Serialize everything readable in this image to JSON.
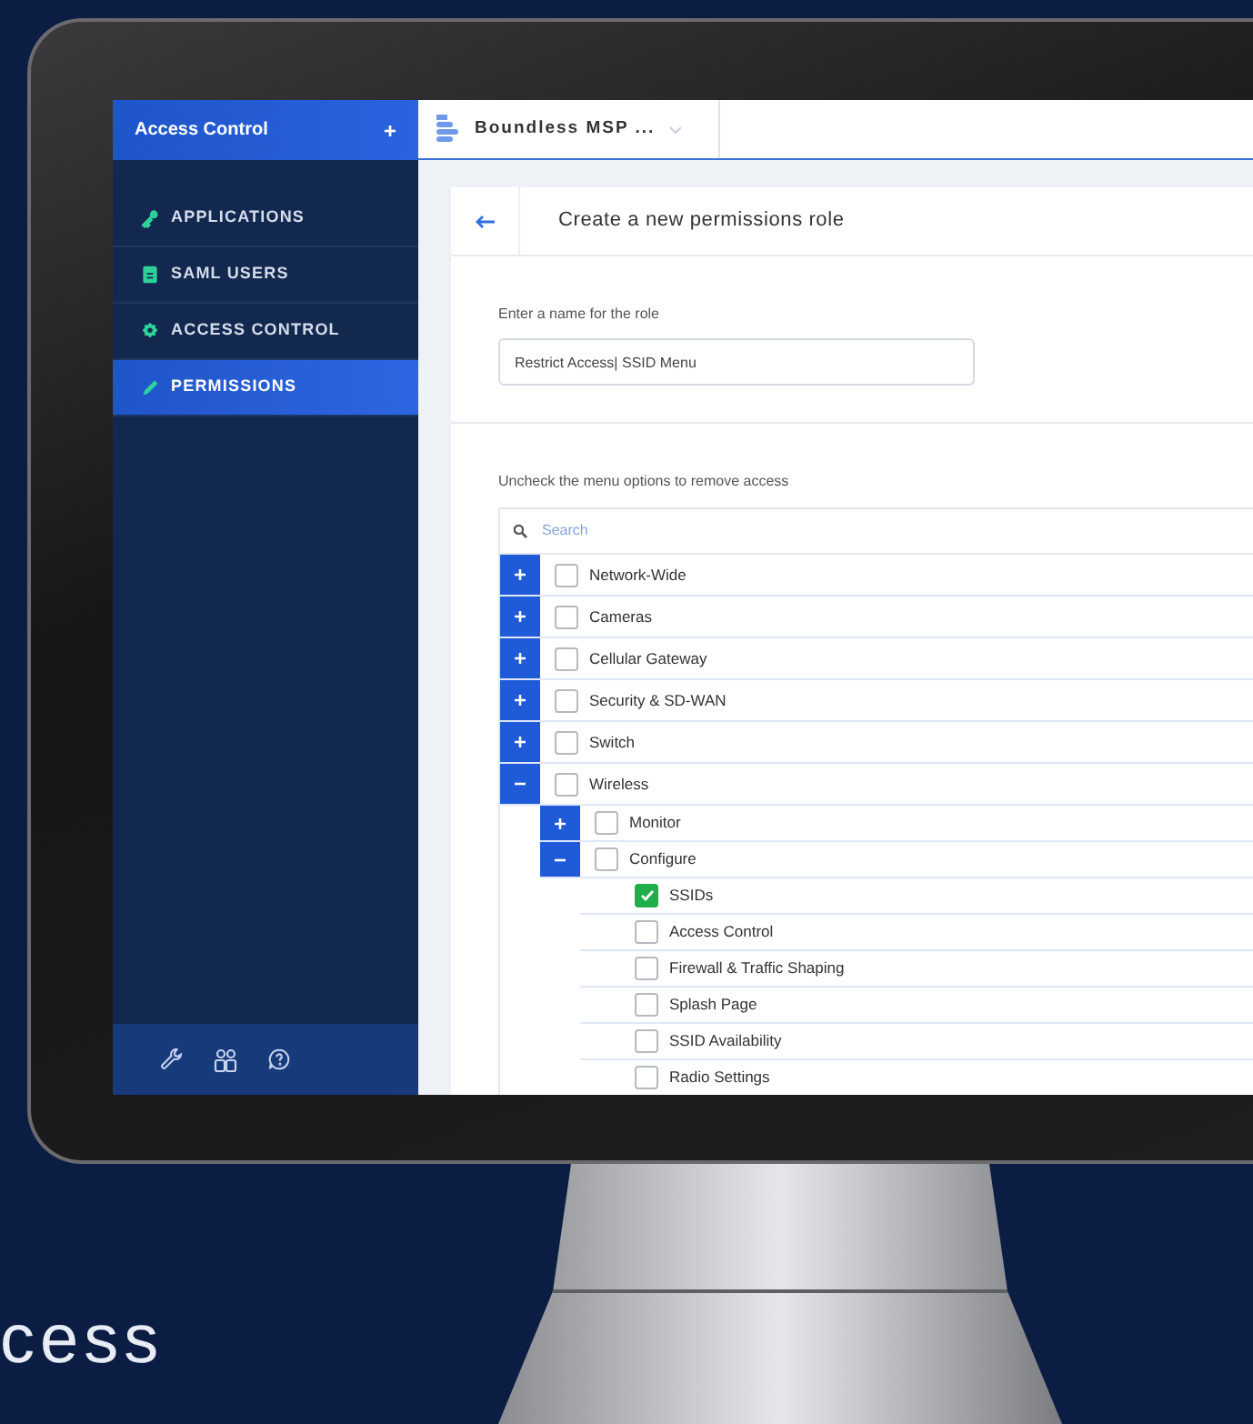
{
  "sidebar": {
    "title": "Access Control",
    "add_button": "+",
    "items": [
      {
        "label": "APPLICATIONS",
        "kind": "key",
        "selected": false
      },
      {
        "label": "SAML USERS",
        "kind": "sheet",
        "selected": false
      },
      {
        "label": "ACCESS CONTROL",
        "kind": "gear",
        "selected": false
      },
      {
        "label": "PERMISSIONS",
        "kind": "pencil",
        "selected": true
      }
    ]
  },
  "topbar": {
    "organization": "Boundless MSP ..."
  },
  "card": {
    "title": "Create a new permissions role",
    "name_label": "Enter a name for the role",
    "name_value": "Restrict Access| SSID Menu",
    "menu_label": "Uncheck the menu options to remove access",
    "search_placeholder": "Search",
    "tree": [
      {
        "label": "Network-Wide",
        "checked": false,
        "expanded": false
      },
      {
        "label": "Cameras",
        "checked": false,
        "expanded": false
      },
      {
        "label": "Cellular Gateway",
        "checked": false,
        "expanded": false
      },
      {
        "label": "Security & SD-WAN",
        "checked": false,
        "expanded": false
      },
      {
        "label": "Switch",
        "checked": false,
        "expanded": false
      },
      {
        "label": "Wireless",
        "checked": false,
        "expanded": true,
        "children": [
          {
            "label": "Monitor",
            "checked": false,
            "expanded": false
          },
          {
            "label": "Configure",
            "checked": false,
            "expanded": true,
            "children": [
              {
                "label": "SSIDs",
                "checked": true
              },
              {
                "label": "Access Control",
                "checked": false
              },
              {
                "label": "Firewall & Traffic Shaping",
                "checked": false
              },
              {
                "label": "Splash Page",
                "checked": false
              },
              {
                "label": "SSID Availability",
                "checked": false
              },
              {
                "label": "Radio Settings",
                "checked": false
              }
            ]
          }
        ]
      }
    ]
  },
  "caption": "cess"
}
